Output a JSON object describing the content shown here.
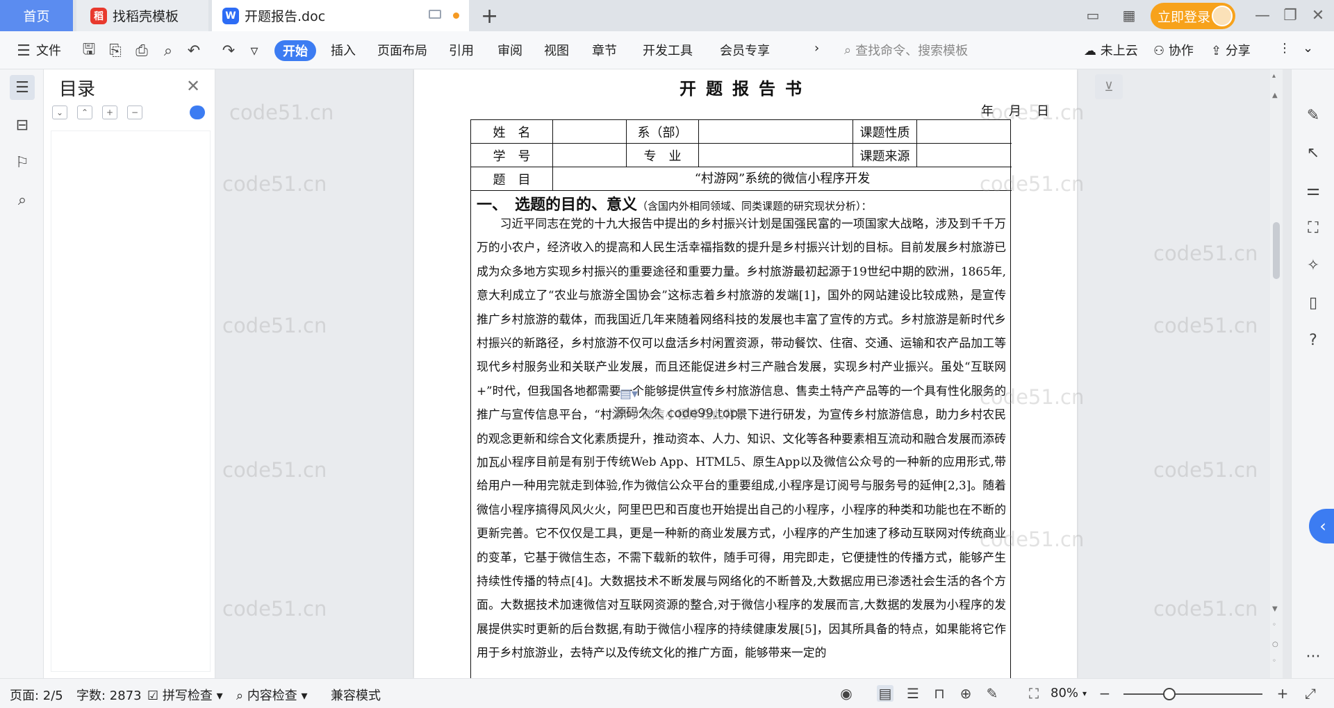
{
  "tabs": {
    "home": "首页",
    "template": "找稻壳模板",
    "document": "开题报告.doc",
    "login": "立即登录"
  },
  "ribbon": {
    "file": "文件",
    "tabs": [
      "开始",
      "插入",
      "页面布局",
      "引用",
      "审阅",
      "视图",
      "章节",
      "开发工具",
      "会员专享"
    ],
    "search_placeholder": "查找命令、搜索模板",
    "cloud": "未上云",
    "collab": "协作",
    "share": "分享"
  },
  "toc": {
    "title": "目录"
  },
  "document": {
    "title": "开题报告书",
    "date": "年　月　日",
    "form": {
      "name_label": "姓　名",
      "dept_label": "系（部）",
      "nature_label": "课题性质",
      "id_label": "学　号",
      "major_label": "专　业",
      "source_label": "课题来源",
      "topic_label": "题　目",
      "topic_value": "“村游网”系统的微信小程序开发"
    },
    "section_heading": "一、　选题的目的、意义",
    "section_sub": "（含国内外相同领域、同类课题的研究现状分析）：",
    "para1": "习近平同志在党的十九大报告中提出的乡村振兴计划是国强民富的一项国家大战略，涉及到千千万万的小农户，经济收入的提高和人民生活幸福指数的提升是乡村振兴计划的目标。目前发展乡村旅游已成为众多地方实现乡村振兴的重要途径和重要力量。乡村旅游最初起源于19世纪中期的欧洲，1865年,意大利成立了“农业与旅游全国协会”这标志着乡村旅游的发端[1]，国外的网站建设比较成熟，是宣传推广乡村旅游的载体，而我国近几年来随着网络科技的发展也丰富了宣传的方式。乡村旅游是新时代乡村振兴的新路径，乡村旅游不仅可以盘活乡村闲置资源，带动餐饮、住宿、交通、运输和农产品加工等现代乡村服务业和关联产业发展，而且还能促进乡村三产融合发展，实现乡村产业振兴。虽处“互联网+”时代，但我国各地都需要一个能够提供宣传乡村旅游信息、售卖土特产产品等的一个具有性化服务的推广与宣传信息平台，“村游网”微信小程序在此背景下进行研发，为宣传乡村旅游信息，助力乡村农民的观念更新和综合文化素质提升，推动资本、人力、知识、文化等各种要素相互流动和融合发展而添砖加瓦。",
    "para2": "小程序目前是有别于传统Web App、HTML5、原生App以及微信公众号的一种新的应用形式,带给用户一种用完就走到体验,作为微信公众平台的重要组成,小程序是订阅号与服务号的延伸[2,3]。随着微信小程序搞得风风火火，阿里巴巴和百度也开始提出自己的小程序，小程序的种类和功能也在不断的更新完善。它不仅仅是工具，更是一种新的商业发展方式，小程序的产生加速了移动互联网对传统商业的变革，它基于微信生态，不需下载新的软件，随手可得，用完即走，它便捷性的传播方式，能够产生持续性传播的特点[4]。大数据技术不断发展与网络化的不断普及,大数据应用已渗透社会生活的各个方面。大数据技术加速微信对互联网资源的整合,对于微信小程序的发展而言,大数据的发展为小程序的发展提供实时更新的后台数据,有助于微信小程序的持续健康发展[5]，因其所具备的特点，如果能将它作用于乡村旅游业，去特产以及传统文化的推广方面，能够带来一定的",
    "overlay_text": "源码久久 code99.top"
  },
  "watermark": "code51.cn",
  "statusbar": {
    "page": "页面: 2/5",
    "words": "字数: 2873",
    "spell": "拼写检查",
    "content": "内容检查",
    "compat": "兼容模式",
    "zoom": "80%",
    "zoom_level": 0.33
  },
  "colors": {
    "accent": "#3c7cf2",
    "home_tab": "#5b8cf0",
    "login": "#f7a21b"
  }
}
